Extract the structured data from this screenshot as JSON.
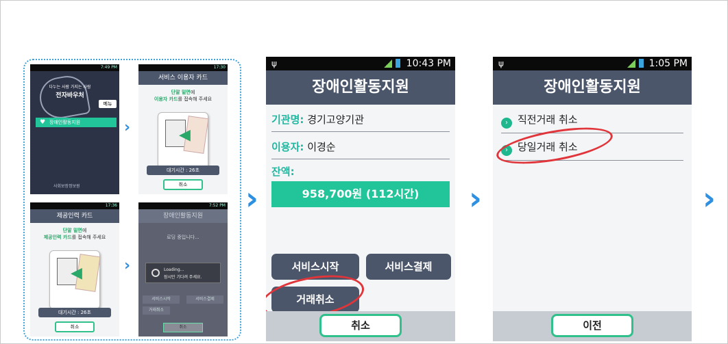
{
  "mini_screens": {
    "s1": {
      "status": "7:49 PM",
      "tagline": "다누는 사람 가지는 사람",
      "title": "전자바우처",
      "menu_btn": "메뉴",
      "item": "장애인활동지원",
      "footer_logo": "사회보장정보원"
    },
    "s2": {
      "status": "17:30",
      "header": "서비스 이용자 카드",
      "line1_green": "단말 밑면",
      "line1_rest": "에",
      "line2_green": "이용자 카드",
      "line2_rest": "를 접속해 주세요",
      "wait": "대기시간 : 26초",
      "cancel": "취소"
    },
    "s3": {
      "status": "17:36",
      "header": "제공인력 카드",
      "line1_green": "단말 밑면",
      "line1_rest": "에",
      "line2_green": "제공인력 카드",
      "line2_rest": "를 접속해 주세요",
      "wait": "대기시간 : 26초",
      "cancel": "취소"
    },
    "s4": {
      "status": "7:52 PM",
      "header": "장애인활동지원",
      "loading_note": "로딩 중입니다...",
      "loading1": "Loading...",
      "loading2": "잠시만 기다려 주세요.",
      "b1": "서비스시작",
      "b2": "서비스결제",
      "b3": "거래취소",
      "cancel": "취소"
    }
  },
  "phone2": {
    "time": "10:43 PM",
    "title": "장애인활동지원",
    "org_label": "기관명:",
    "org_value": "경기고양기관",
    "user_label": "이용자:",
    "user_value": "이경순",
    "balance_label": "잔액:",
    "balance_value": "958,700원 (112시간)",
    "btn_start": "서비스시작",
    "btn_pay": "서비스결제",
    "btn_cancel_tx": "거래취소",
    "cancel": "취소"
  },
  "phone3": {
    "time": "1:05 PM",
    "title": "장애인활동지원",
    "opt1": "직전거래 취소",
    "opt2": "당일거래 취소",
    "prev": "이전"
  },
  "icons": {
    "arrow": "chevron-right-icon",
    "usb": "usb-icon",
    "heart": "heart-icon",
    "check": "check-circle-icon"
  },
  "colors": {
    "accent_blue": "#2f8fe0",
    "teal": "#22c49a",
    "header": "#4c566a",
    "highlight_red": "#e0353a"
  }
}
